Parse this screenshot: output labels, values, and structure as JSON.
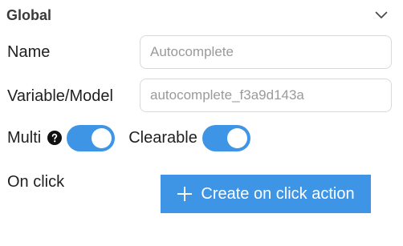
{
  "section": {
    "title": "Global",
    "chevron_icon": "chevron-down-icon"
  },
  "fields": {
    "name": {
      "label": "Name",
      "placeholder": "Autocomplete",
      "value": ""
    },
    "variable": {
      "label": "Variable/Model",
      "placeholder": "autocomplete_f3a9d143a",
      "value": ""
    }
  },
  "toggles": {
    "multi": {
      "label": "Multi",
      "help_icon": "question-circle-icon",
      "on": true
    },
    "clearable": {
      "label": "Clearable",
      "on": true
    }
  },
  "on_click": {
    "label": "On click",
    "button_label": "Create on click action",
    "button_icon": "plus-icon"
  },
  "colors": {
    "accent": "#3e95e6",
    "input_border": "#d9d9d9",
    "placeholder": "#9a9a9a"
  }
}
